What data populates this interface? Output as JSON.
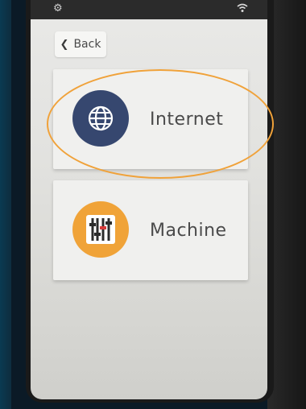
{
  "statusbar": {
    "left_icon": "gear-icon",
    "right_icon": "wifi-icon"
  },
  "back_button": {
    "label": "Back",
    "icon": "chevron-left-icon"
  },
  "tiles": [
    {
      "label": "Internet",
      "icon": "globe-icon",
      "icon_color": "#36476f"
    },
    {
      "label": "Machine",
      "icon": "sliders-icon",
      "icon_color": "#f0a338"
    }
  ],
  "annotation": {
    "type": "highlight-ellipse",
    "color": "#f0a23a",
    "target": "Internet"
  }
}
